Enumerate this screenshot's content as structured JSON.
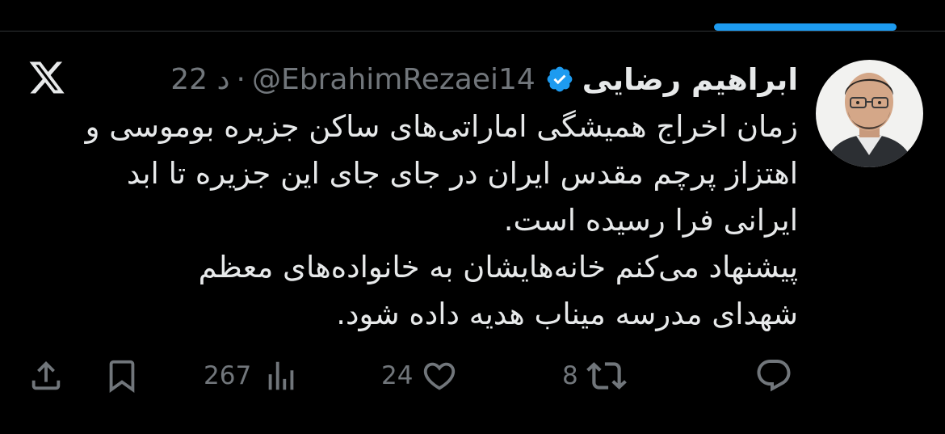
{
  "colors": {
    "background": "#000000",
    "text": "#e7e9ea",
    "muted": "#71767b",
    "accent": "#1d9bf0",
    "divider": "#2f3336"
  },
  "tweet": {
    "display_name": "ابراهیم رضایی",
    "verified_icon": "verified-badge-icon",
    "handle": "@EbrahimRezaei14",
    "separator": "·",
    "time": "22 د",
    "text_lines": [
      "زمان اخراج همیشگی اماراتی‌های ساکن جزیره بوموسی و",
      "اهتزاز پرچم مقدس ایران در جای جای این جزیره تا ابد",
      "ایرانی فرا رسیده است.",
      "پیشنهاد می‌کنم خانه‌هایشان به خانواده‌های معظم",
      "شهدای مدرسه میناب هدیه داده شود."
    ]
  },
  "actions": {
    "reply": {
      "icon": "reply-icon",
      "count": ""
    },
    "retweet": {
      "icon": "retweet-icon",
      "count": "8"
    },
    "like": {
      "icon": "heart-icon",
      "count": "24"
    },
    "views": {
      "icon": "analytics-icon",
      "count": "267"
    },
    "bookmark": {
      "icon": "bookmark-icon",
      "count": ""
    },
    "share": {
      "icon": "share-icon",
      "count": ""
    }
  }
}
